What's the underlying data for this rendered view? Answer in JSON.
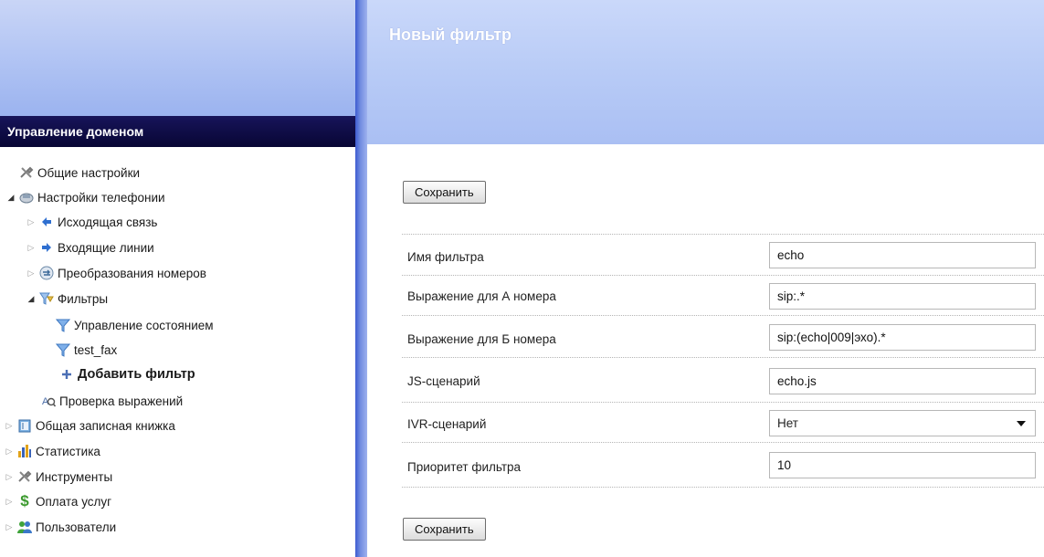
{
  "sidebar": {
    "header": "Управление доменом",
    "items": [
      {
        "label": "Общие настройки",
        "icon": "tools-icon"
      },
      {
        "label": "Настройки телефонии",
        "icon": "phone-settings-icon"
      },
      {
        "label": "Исходящая связь",
        "icon": "arrow-left-icon"
      },
      {
        "label": "Входящие линии",
        "icon": "arrow-right-icon"
      },
      {
        "label": "Преобразования номеров",
        "icon": "number-transform-icon"
      },
      {
        "label": "Фильтры",
        "icon": "filters-icon"
      },
      {
        "label": "Управление состоянием",
        "icon": "filter-icon"
      },
      {
        "label": "test_fax",
        "icon": "filter-icon"
      },
      {
        "label": "Добавить фильтр",
        "icon": "plus-icon"
      },
      {
        "label": "Проверка выражений",
        "icon": "expression-check-icon"
      },
      {
        "label": "Общая записная книжка",
        "icon": "address-book-icon"
      },
      {
        "label": "Статистика",
        "icon": "statistics-icon"
      },
      {
        "label": "Инструменты",
        "icon": "tools-icon"
      },
      {
        "label": "Оплата услуг",
        "icon": "dollar-icon"
      },
      {
        "label": "Пользователи",
        "icon": "users-icon"
      }
    ]
  },
  "page": {
    "title": "Новый фильтр",
    "save_label": "Сохранить"
  },
  "form": {
    "filter_name": {
      "label": "Имя фильтра",
      "value": "echo"
    },
    "expr_a": {
      "label": "Выражение для А номера",
      "value": "sip:.*"
    },
    "expr_b": {
      "label": "Выражение для Б номера",
      "value": "sip:(echo|009|эхо).*"
    },
    "js_script": {
      "label": "JS-сценарий",
      "value": "echo.js"
    },
    "ivr_script": {
      "label": "IVR-сценарий",
      "value": "Нет"
    },
    "priority": {
      "label": "Приоритет фильтра",
      "value": "10"
    }
  },
  "colors": {
    "header_dark": "#0d0b45",
    "panel_blue": "#b4c6f4",
    "divider_blue": "#4a68d4"
  }
}
